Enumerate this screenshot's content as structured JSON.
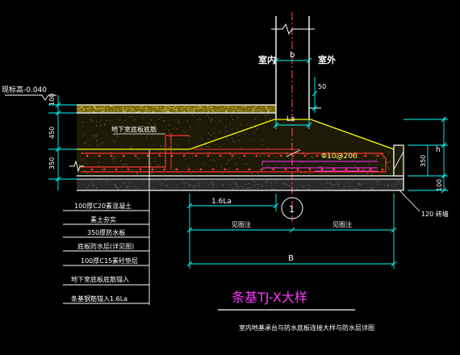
{
  "labels": {
    "indoor": "室内",
    "outdoor": "室外",
    "width_b": "b",
    "dim_50": "50",
    "dim_100_top": "100",
    "dim_450": "450",
    "dim_350_left": "350",
    "elevation": "现标高-0.040",
    "la": "La",
    "rebar": "Φ10@200",
    "basement_label": "地下室底板底筋",
    "dim_h": "h",
    "dim_350_right": "350",
    "dim_100_right": "100",
    "dim_1_6la": "1.6La",
    "marker": "1",
    "dim_left_part": "见图注",
    "dim_right_part": "见图注",
    "total_width": "B",
    "wall_120": "120 砖墙",
    "title": "条基TJ-X大样",
    "subtitle": "室内地基承台与防水底板连接大样与防水层详图"
  },
  "layer_notes": [
    "100厚C20素混凝土",
    "素土夯实",
    "350厚防水板",
    "底板防水层(详见图)",
    "100厚C15素砼垫层",
    "地下室底板底筋锚入",
    "条基钢筋锚入1.6La"
  ],
  "colors": {
    "background": "#000000",
    "concrete_outline": "#ffffff",
    "footing_outline": "#ffff00",
    "rebar": "#ff3333",
    "dimension": "#00ffff",
    "fill_top": "#7a6a10",
    "fill_layers": "#1d1a08",
    "blinding": "#2a2a2a",
    "title": "#ff33ff"
  }
}
